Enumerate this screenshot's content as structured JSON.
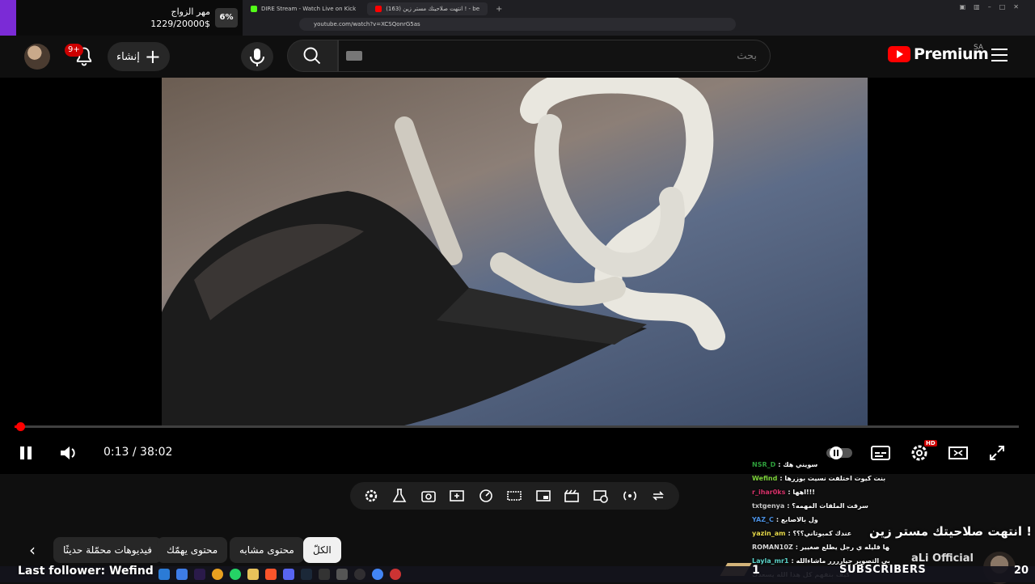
{
  "overlay_goal": {
    "title": "مهر الزواج",
    "amount": "1229/20000$",
    "percent": "6%"
  },
  "browser": {
    "tabs": [
      {
        "label": "DIRE Stream - Watch Live on Kick",
        "color": "#53fc18"
      },
      {
        "label": "(163) انتهت صلاحيتك مستر زين ! - be",
        "color": "#ff0000"
      }
    ],
    "url": "youtube.com/watch?v=XCSQonrG5as"
  },
  "header": {
    "notification_count": "9+",
    "create_label": "إنشاء",
    "search_placeholder": "بحث",
    "logo_text": "Premium",
    "region": "SA"
  },
  "player": {
    "time_text": "0:13 / 38:02",
    "progress": 0.0057,
    "hd_badge": "HD"
  },
  "chips": {
    "all": "الكلّ",
    "similar": "محتوى مشابه",
    "for_you": "محتوى يهمّك",
    "recent": "فيديوهات محمّلة حديثًا"
  },
  "chat": [
    {
      "user": "NSR_D",
      "msg": "سويني هك",
      "color": "#2e9e3b"
    },
    {
      "user": "Wefind",
      "msg": "بنت كيوت اختلفت نسيت بوزرها",
      "color": "#7dd33a"
    },
    {
      "user": "r_ihar0ks",
      "msg": "اهها!!!",
      "color": "#d9326b"
    },
    {
      "user": "txtgenya",
      "msg": "سرقت الملفات المهمه؟",
      "color": "#c9c9c9"
    },
    {
      "user": "YAZ_C",
      "msg": "ول بالاصابع",
      "color": "#4a8fe0"
    },
    {
      "user": "yazin_am",
      "msg": "عندك كمبوتاني؟؟؟",
      "color": "#e6d94a"
    },
    {
      "user": "ROMAN10Z",
      "msg": "كانون لحالها قليله ي رجل يطلع صغيير",
      "color": "#d8d8d8"
    },
    {
      "user": "Layla_mr1",
      "msg": "وربي التصوير جيارررر ماشاءالله",
      "color": "#5ad1c8"
    },
    {
      "user": "",
      "msg": "كيف بتفهم كل هذا الله يسعدك",
      "color": "#ffffff"
    }
  ],
  "promo": {
    "title": "انتهت صلاحيتك مستر زين !",
    "channel": "aLi Official",
    "subs_label": "SUBSCRIBERS",
    "subs_count": "1",
    "badge": "20"
  },
  "last_follower": "Last follower: Wefind",
  "colors": {
    "accent": "#ff0000",
    "goal_bar": "#7b2bd6"
  }
}
